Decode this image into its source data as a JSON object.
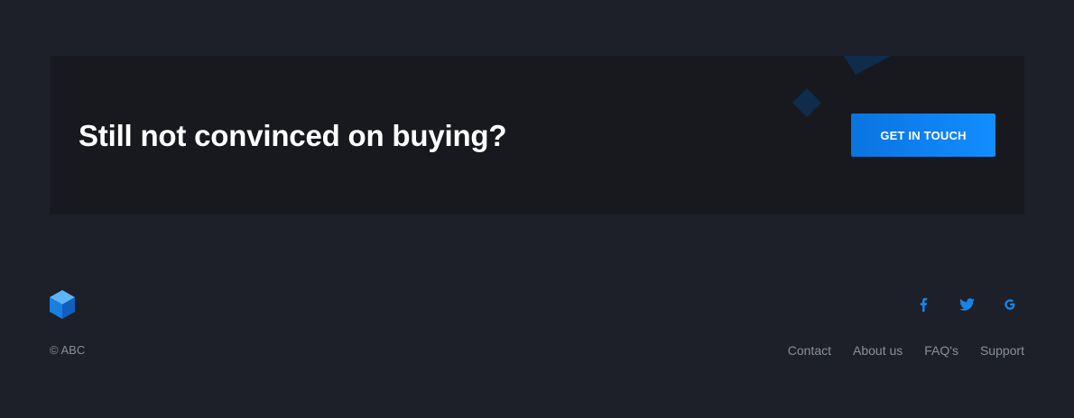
{
  "cta": {
    "title": "Still not convinced on buying?",
    "button_label": "GET IN TOUCH",
    "accent_color": "#0f7eef"
  },
  "footer": {
    "logo_icon": "cube-logo-icon",
    "copyright": "© ABC",
    "social": [
      {
        "name": "facebook-icon",
        "glyph": "f"
      },
      {
        "name": "twitter-icon",
        "glyph": "twitter-bird"
      },
      {
        "name": "google-icon",
        "glyph": "G"
      }
    ],
    "links": [
      "Contact",
      "About us",
      "FAQ's",
      "Support"
    ]
  }
}
